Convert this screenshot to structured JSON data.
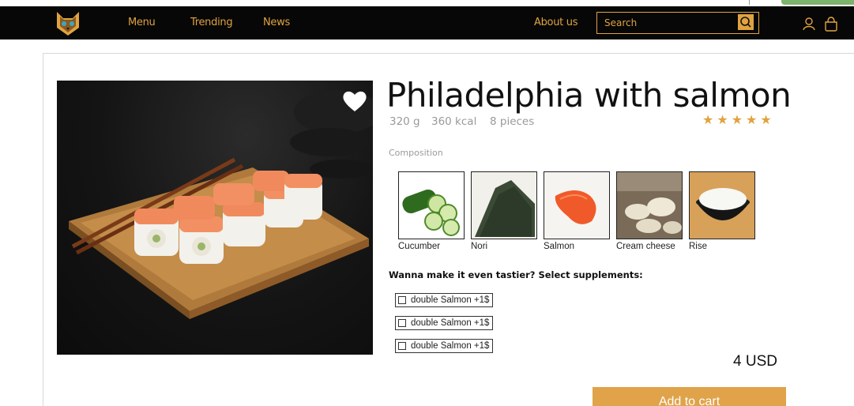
{
  "nav": {
    "menu": "Menu",
    "trending": "Trending",
    "news": "News",
    "about": "About us"
  },
  "search": {
    "placeholder": "Search"
  },
  "product": {
    "title": "Philadelphia with salmon",
    "weight": "320 g",
    "kcal": "360 kcal",
    "pieces": "8 pieces",
    "rating": 5,
    "rating_text": "★★★★★",
    "price": "4 USD"
  },
  "composition": {
    "label": "Composition",
    "ingredients": [
      {
        "label": "Cucumber"
      },
      {
        "label": "Nori"
      },
      {
        "label": "Salmon"
      },
      {
        "label": "Cream cheese"
      },
      {
        "label": "Rise"
      }
    ]
  },
  "supplements": {
    "heading": "Wanna make it even tastier? Select supplements:",
    "items": [
      {
        "label": "double Salmon +1$"
      },
      {
        "label": "double Salmon +1$"
      },
      {
        "label": "double Salmon +1$"
      }
    ]
  },
  "cart": {
    "button_label": "Add to cart"
  },
  "colors": {
    "accent": "#e0a340",
    "topbar": "#070707",
    "button": "#e0a34a"
  }
}
